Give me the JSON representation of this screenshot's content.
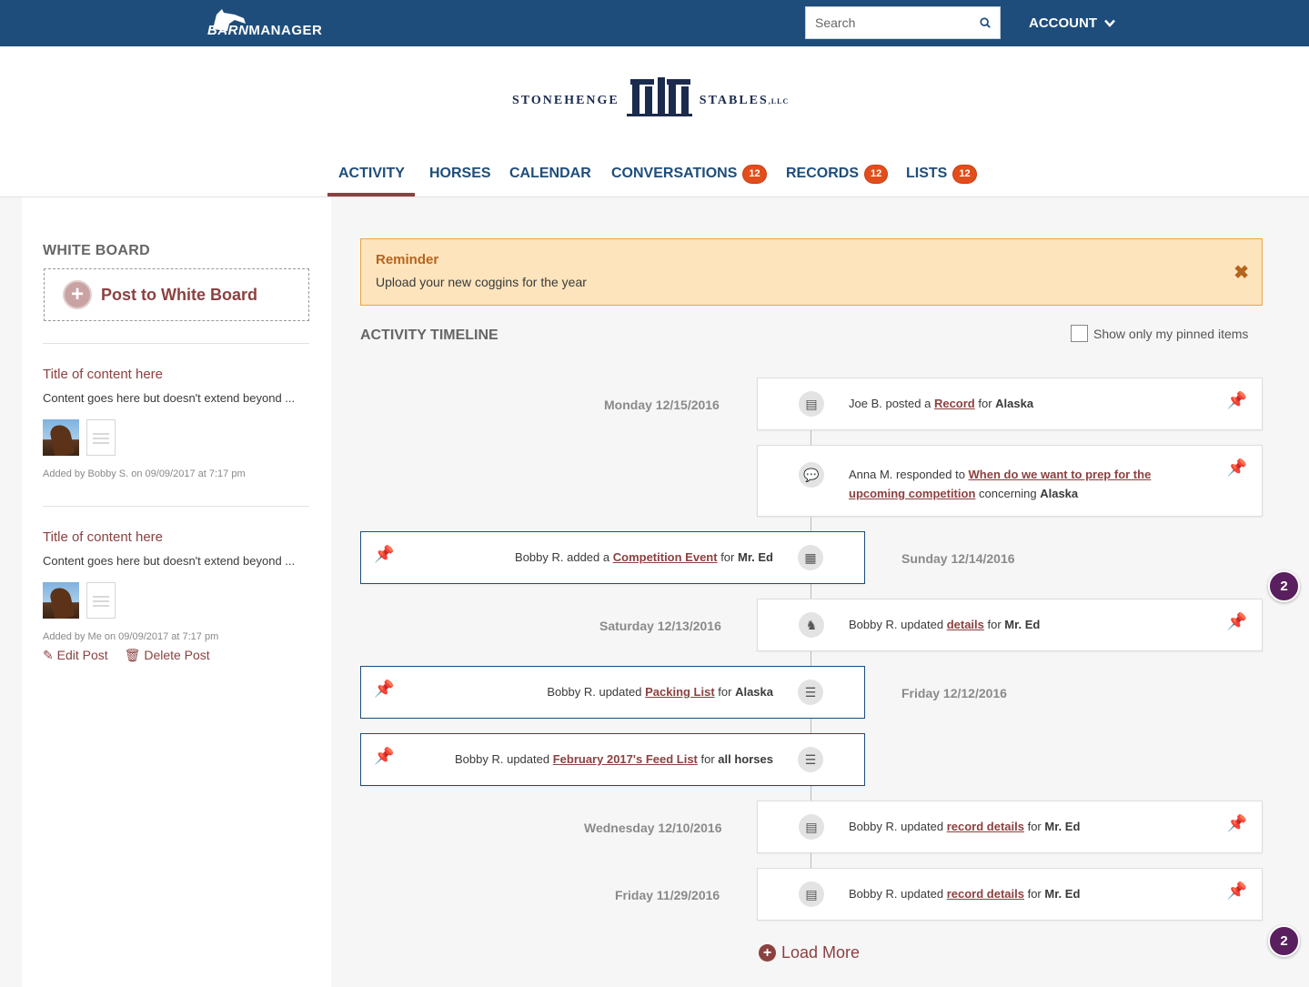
{
  "topbar": {
    "brand_barn": "BARN",
    "brand_manager": "MANAGER",
    "search_placeholder": "Search",
    "account_label": "ACCOUNT"
  },
  "logo": {
    "left": "Stonehenge",
    "right": "Stables",
    "suffix": "LLC"
  },
  "nav": [
    {
      "label": "ACTIVITY",
      "badge": ""
    },
    {
      "label": "HORSES",
      "badge": ""
    },
    {
      "label": "CALENDAR",
      "badge": ""
    },
    {
      "label": "CONVERSATIONS",
      "badge": "12"
    },
    {
      "label": "RECORDS",
      "badge": "12"
    },
    {
      "label": "LISTS",
      "badge": "12"
    }
  ],
  "whiteboard": {
    "title": "WHITE BOARD",
    "post_button": "Post to White Board",
    "posts": [
      {
        "title": "Title of content here",
        "body": "Content goes here but doesn't extend beyond ...",
        "meta": "Added by Bobby S. on 09/09/2017 at 7:17 pm"
      },
      {
        "title": "Title of content here",
        "body": "Content goes here but doesn't extend beyond ...",
        "meta": "Added by Me on 09/09/2017 at 7:17 pm",
        "edit": "Edit Post",
        "delete": "Delete Post"
      }
    ]
  },
  "reminder": {
    "title": "Reminder",
    "text": "Upload your new coggins for the year",
    "close": "✖"
  },
  "timeline": {
    "title": "ACTIVITY TIMELINE",
    "pinned_filter": "Show only my pinned items",
    "load_more": "Load More",
    "badges": [
      "2",
      "2"
    ],
    "items": [
      {
        "date": "Monday 12/15/2016",
        "prefix": "Joe B. posted a ",
        "link": "Record",
        "mid": " for ",
        "target": "Alaska"
      },
      {
        "date": "",
        "prefix": "Anna M. responded to ",
        "link": "When do we want to prep for the upcoming competition",
        "mid": " concerning ",
        "target": "Alaska"
      },
      {
        "date": "Sunday 12/14/2016",
        "prefix": "Bobby R. added a ",
        "link": "Competition Event",
        "mid": " for ",
        "target": "Mr. Ed"
      },
      {
        "date": "Saturday 12/13/2016",
        "prefix": "Bobby R. updated ",
        "link": "details",
        "mid": " for ",
        "target": "Mr. Ed"
      },
      {
        "date": "Friday 12/12/2016",
        "prefix": "Bobby R. updated ",
        "link": "Packing List",
        "mid": " for ",
        "target": "Alaska"
      },
      {
        "date": "",
        "prefix": "Bobby R. updated ",
        "link": "February 2017's Feed List",
        "mid": " for ",
        "target": "all horses"
      },
      {
        "date": "Wednesday 12/10/2016",
        "prefix": "Bobby R. updated ",
        "link": "record details",
        "mid": " for ",
        "target": "Mr. Ed"
      },
      {
        "date": "Friday 11/29/2016",
        "prefix": "Bobby R. updated ",
        "link": "record details",
        "mid": " for ",
        "target": "Mr. Ed"
      }
    ]
  }
}
